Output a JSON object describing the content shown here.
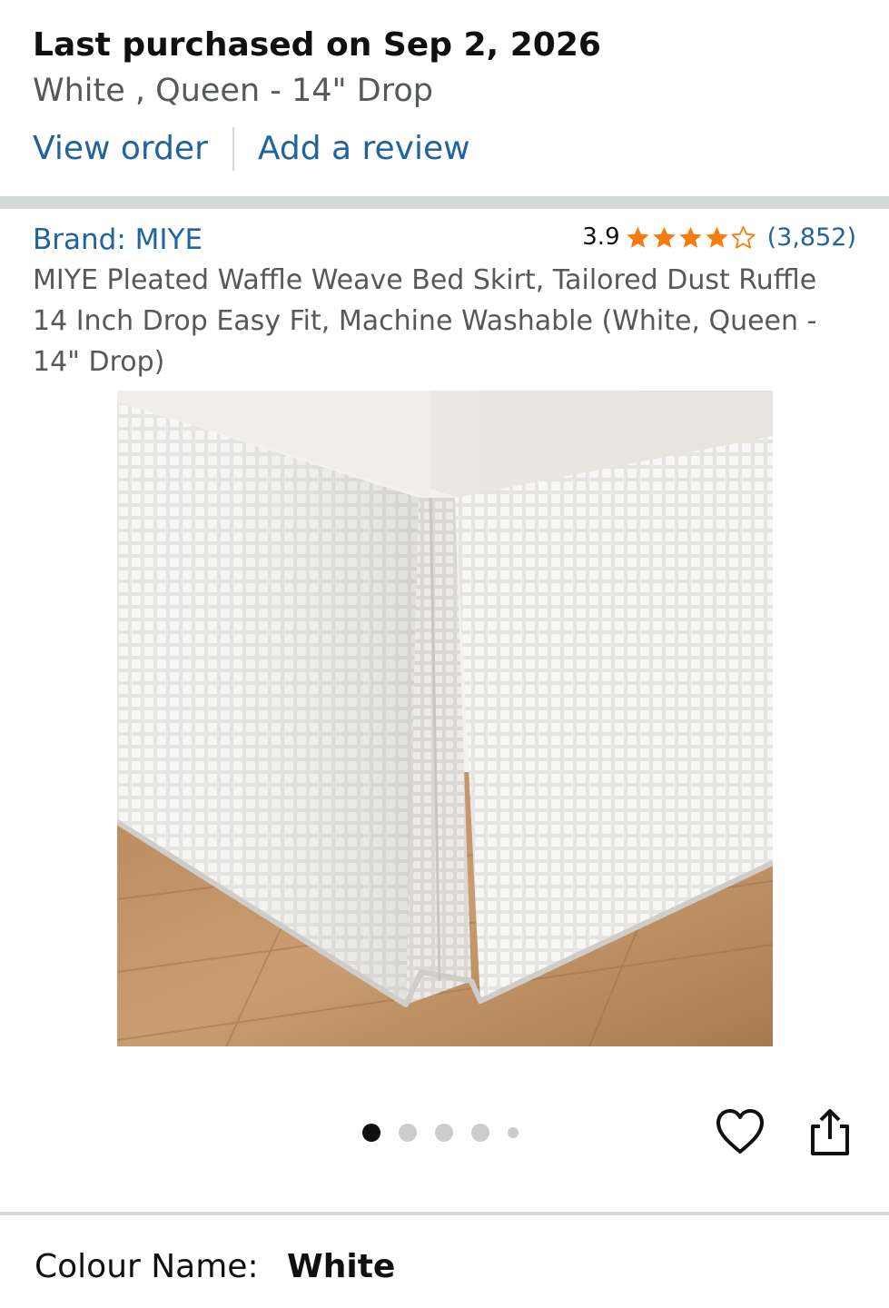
{
  "purchase": {
    "title": "Last purchased on Sep 2, 2026",
    "variant": "White , Queen - 14\" Drop",
    "view_order": "View order",
    "add_review": "Add a review"
  },
  "product": {
    "brand": "Brand: MIYE",
    "rating": "3.9",
    "stars": 3.9,
    "review_count": "(3,852)",
    "title": "MIYE Pleated Waffle Weave Bed Skirt, Tailored Dust Ruffle 14 Inch Drop Easy Fit, Machine Washable (White, Queen - 14\" Drop)"
  },
  "gallery": {
    "image_icon": "product-photo",
    "active_index": 0,
    "dot_count": 5,
    "wishlist_icon": "heart-icon",
    "share_icon": "share-icon"
  },
  "variation": {
    "label": "Colour Name:",
    "value": "White"
  },
  "colors": {
    "link": "#2162a1",
    "star": "#f57d0f",
    "text": "#0f1111",
    "secondary_text": "#565959",
    "separator": "#d5d9d9"
  }
}
